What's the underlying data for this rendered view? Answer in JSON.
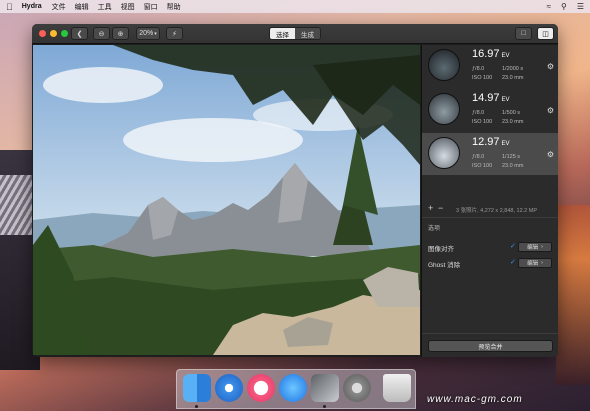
{
  "menubar": {
    "app_name": "Hydra",
    "items": [
      "文件",
      "编辑",
      "工具",
      "视图",
      "窗口",
      "帮助"
    ]
  },
  "toolbar": {
    "zoom_value": "20%",
    "tabs": [
      "选择",
      "生成"
    ],
    "active_tab_index": 0
  },
  "exposures": [
    {
      "ev_value": "16.97",
      "ev_unit": "EV",
      "aperture": "ƒ/8.0",
      "shutter": "1/2000 s",
      "iso": "ISO 100",
      "focal": "23.0 mm"
    },
    {
      "ev_value": "14.97",
      "ev_unit": "EV",
      "aperture": "ƒ/8.0",
      "shutter": "1/500 s",
      "iso": "ISO 100",
      "focal": "23.0 mm"
    },
    {
      "ev_value": "12.97",
      "ev_unit": "EV",
      "aperture": "ƒ/8.0",
      "shutter": "1/125 s",
      "iso": "ISO 100",
      "focal": "23.0 mm"
    }
  ],
  "selected_exposure_index": 2,
  "photo_summary": "3 张照片, 4,272 x 2,848, 12.2 MP",
  "options": {
    "title": "选项",
    "rows": [
      {
        "label": "图像对齐",
        "checked": true,
        "button": "编辑"
      },
      {
        "label": "Ghost 消除",
        "checked": true,
        "button": "编辑"
      }
    ]
  },
  "merge_button": "预览合并",
  "watermark": "www.mac-gm.com",
  "colors": {
    "accent": "#3d8ef0",
    "window_bg": "#1e1e1e",
    "panel_bg": "#2b2b2b"
  }
}
